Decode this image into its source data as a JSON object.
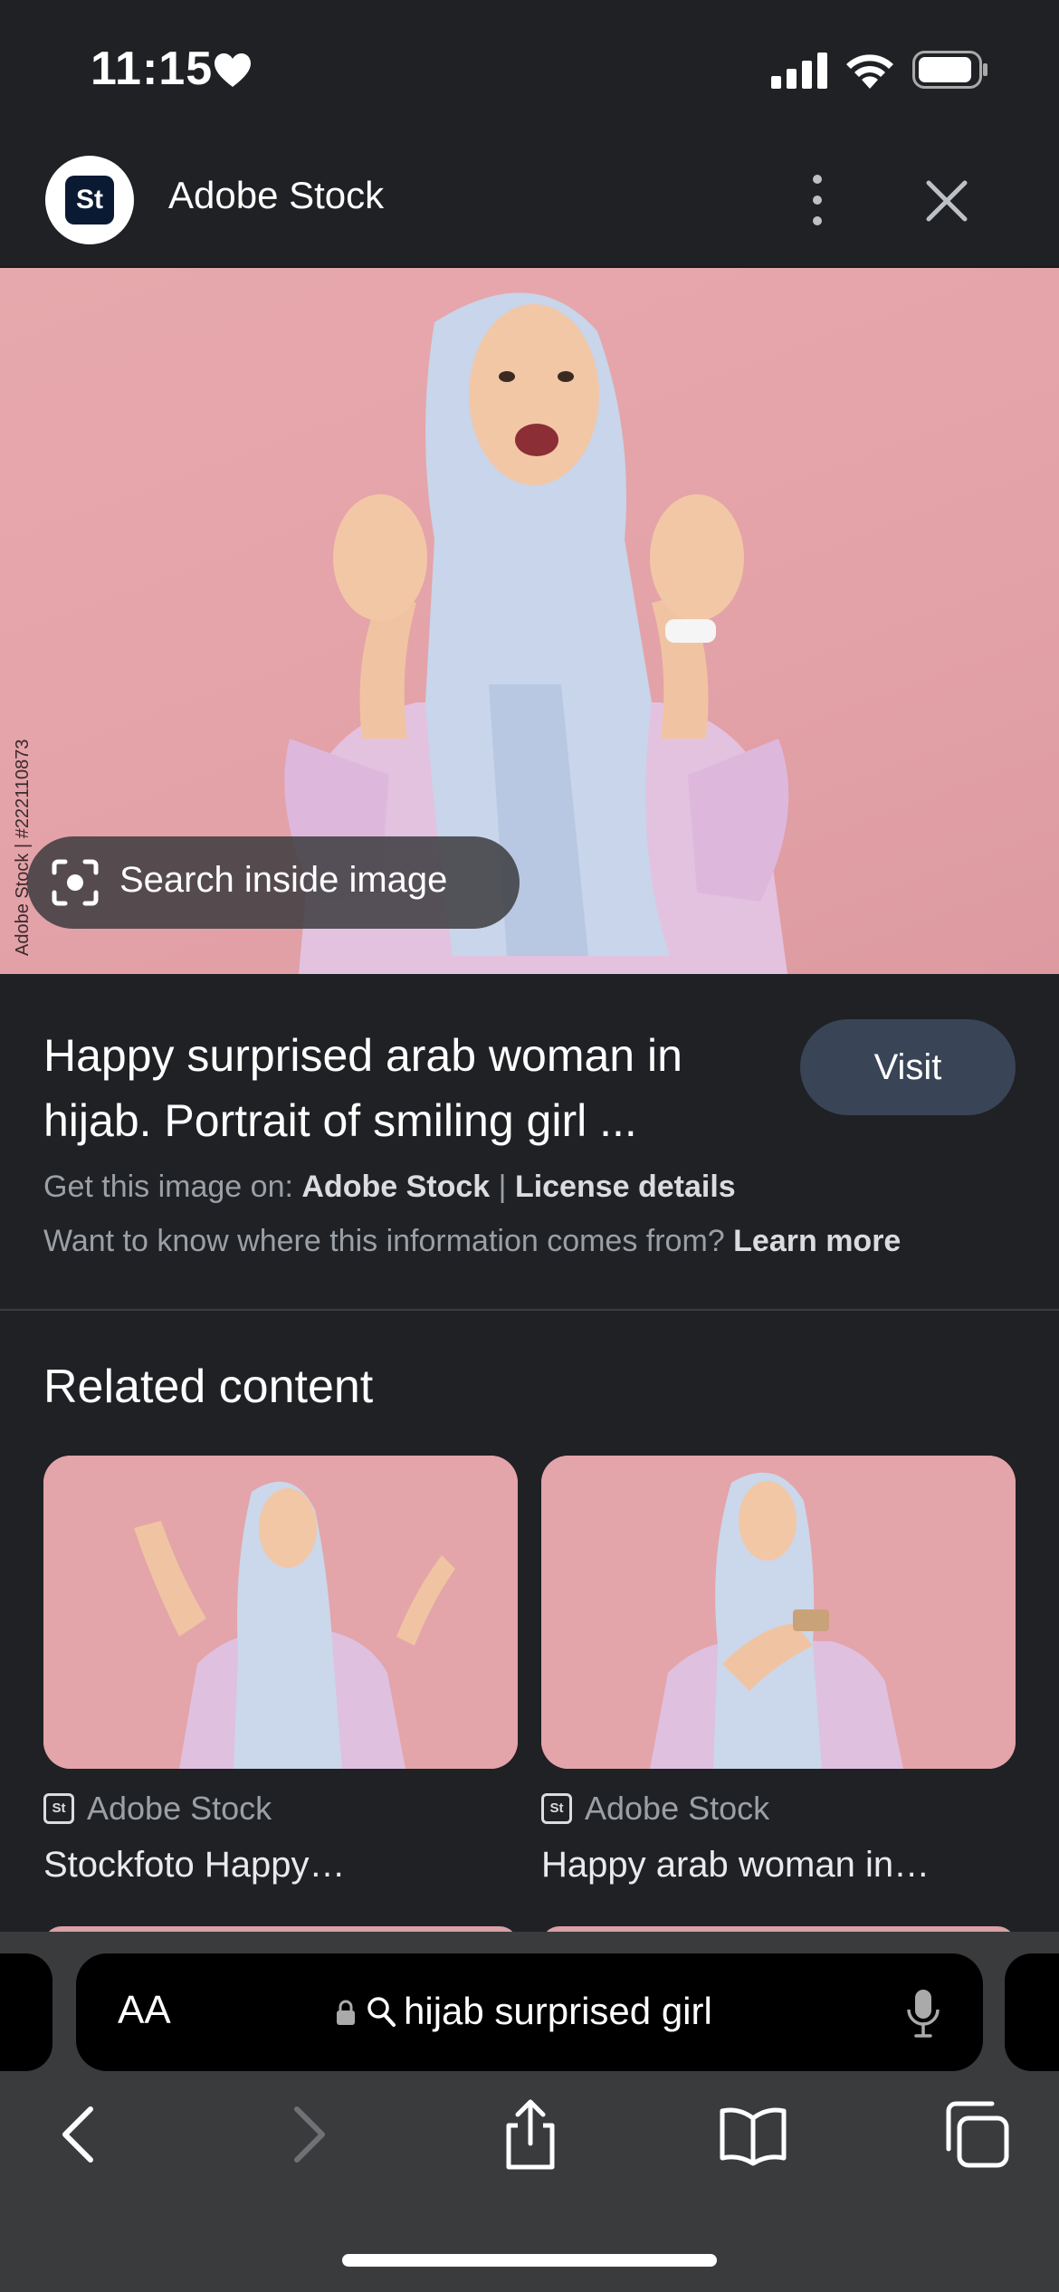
{
  "status_bar": {
    "time": "11:15"
  },
  "header": {
    "logo_text": "St",
    "title": "Adobe Stock"
  },
  "hero": {
    "credit": "Adobe Stock | #222110873",
    "search_inside_label": "Search inside image"
  },
  "result": {
    "title": "Happy surprised arab woman in hijab. Portrait of smiling girl ...",
    "visit_label": "Visit",
    "source_prefix": "Get this image on:",
    "source_name": "Adobe Stock",
    "separator": "|",
    "license_label": "License details",
    "info_question": "Want to know where this information comes from?",
    "learn_more": "Learn more"
  },
  "related": {
    "heading": "Related content",
    "cards": [
      {
        "source": "Adobe Stock",
        "title": "Stockfoto Happy…",
        "logo_text": "St"
      },
      {
        "source": "Adobe Stock",
        "title": "Happy arab woman in…",
        "logo_text": "St"
      }
    ]
  },
  "browser": {
    "aa_label": "AA",
    "address_text": "hijab surprised girl"
  },
  "colors": {
    "background": "#202124",
    "visit_button": "#394457",
    "hero_pink": "#e3a2a8",
    "toolbar": "#3a3b3d"
  }
}
